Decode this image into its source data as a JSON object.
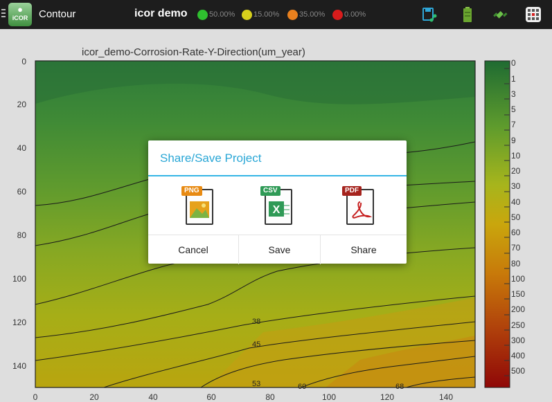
{
  "topbar": {
    "logo_text": "iCOR",
    "screen_title": "Contour",
    "project_name": "icor demo",
    "status_indicators": [
      {
        "color": "#2fbf2f",
        "label": "50.00%"
      },
      {
        "color": "#d6cf1c",
        "label": "15.00%"
      },
      {
        "color": "#e8801e",
        "label": "35.00%"
      },
      {
        "color": "#d71c1c",
        "label": "0.00%"
      }
    ],
    "icons": [
      "save-share-icon",
      "battery-icon",
      "satellite-icon",
      "grid-icon"
    ]
  },
  "chart_data": {
    "type": "heatmap",
    "subtype": "contour",
    "title": "icor_demo-Corrosion-Rate-Y-Direction(um_year)",
    "x_ticks": [
      "0",
      "20",
      "40",
      "60",
      "80",
      "100",
      "120",
      "140"
    ],
    "y_ticks": [
      "0",
      "20",
      "40",
      "60",
      "80",
      "100",
      "120",
      "140"
    ],
    "xlim": [
      0,
      150
    ],
    "ylim": [
      0,
      150
    ],
    "y_inverted": true,
    "colorbar_labels": [
      "0",
      "1",
      "3",
      "5",
      "7",
      "9",
      "10",
      "20",
      "30",
      "40",
      "50",
      "60",
      "70",
      "80",
      "100",
      "150",
      "200",
      "250",
      "300",
      "400",
      "500"
    ],
    "colorbar_colors": [
      "#1f6b32",
      "#5e9b2d",
      "#a7b51c",
      "#c9a60d",
      "#c87a0a",
      "#b0410b",
      "#8f0707"
    ],
    "contour_labels": [
      "38",
      "45",
      "53",
      "60",
      "68"
    ]
  },
  "dialog": {
    "title": "Share/Save Project",
    "formats": [
      {
        "tag": "PNG",
        "icon": "png-file-icon",
        "tag_color": "#e88a12"
      },
      {
        "tag": "CSV",
        "icon": "csv-file-icon",
        "tag_color": "#2f9a56"
      },
      {
        "tag": "PDF",
        "icon": "pdf-file-icon",
        "tag_color": "#a5231d"
      }
    ],
    "buttons": {
      "cancel": "Cancel",
      "save": "Save",
      "share": "Share"
    }
  }
}
